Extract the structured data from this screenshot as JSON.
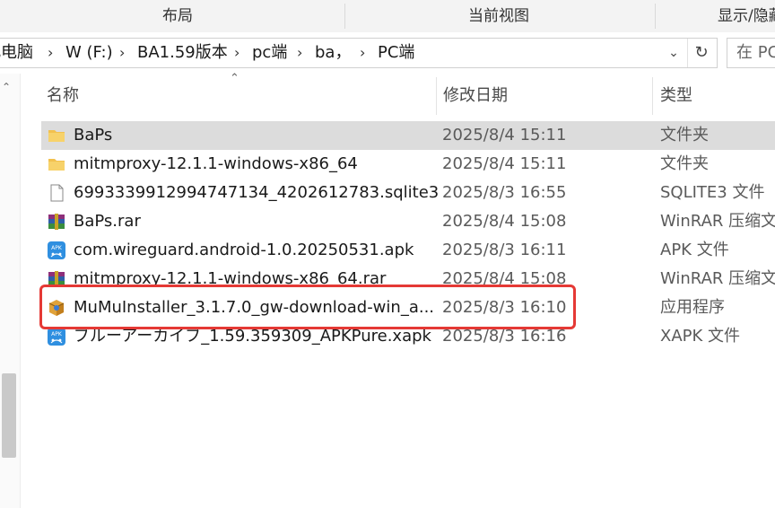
{
  "ribbon": {
    "groups": [
      "布局",
      "当前视图",
      "显示/隐藏"
    ]
  },
  "address": {
    "crumbs": [
      "此电脑",
      "W (F:)",
      "BA1.59版本",
      "pc端",
      "ba，",
      "PC端"
    ],
    "search_placeholder": "在 PC端 中搜索"
  },
  "columns": {
    "name": "名称",
    "date": "修改日期",
    "type": "类型"
  },
  "files": [
    {
      "name": "BaPs",
      "date": "2025/8/4 15:11",
      "type": "文件夹",
      "icon": "folder-icon",
      "selected": true
    },
    {
      "name": "mitmproxy-12.1.1-windows-x86_64",
      "date": "2025/8/4 15:11",
      "type": "文件夹",
      "icon": "folder-icon"
    },
    {
      "name": "6993339912994747134_4202612783.sqlite3",
      "date": "2025/8/3 16:55",
      "type": "SQLITE3 文件",
      "icon": "file-icon"
    },
    {
      "name": "BaPs.rar",
      "date": "2025/8/4 15:08",
      "type": "WinRAR 压缩文件",
      "icon": "winrar-icon"
    },
    {
      "name": "com.wireguard.android-1.0.20250531.apk",
      "date": "2025/8/3 16:11",
      "type": "APK 文件",
      "icon": "apk-icon"
    },
    {
      "name": "mitmproxy-12.1.1-windows-x86_64.rar",
      "date": "2025/8/4 15:08",
      "type": "WinRAR 压缩文件",
      "icon": "winrar-icon"
    },
    {
      "name": "MuMuInstaller_3.1.7.0_gw-download-win_a...",
      "date": "2025/8/3 16:10",
      "type": "应用程序",
      "icon": "installer-icon",
      "highlighted": true
    },
    {
      "name": "ブルーアーカイブ_1.59.359309_APKPure.xapk",
      "date": "2025/8/3 16:16",
      "type": "XAPK 文件",
      "icon": "apk-icon"
    }
  ],
  "colors": {
    "highlight": "#e53935",
    "selected_row": "#dcdcdc",
    "folder": "#f2c14e"
  }
}
